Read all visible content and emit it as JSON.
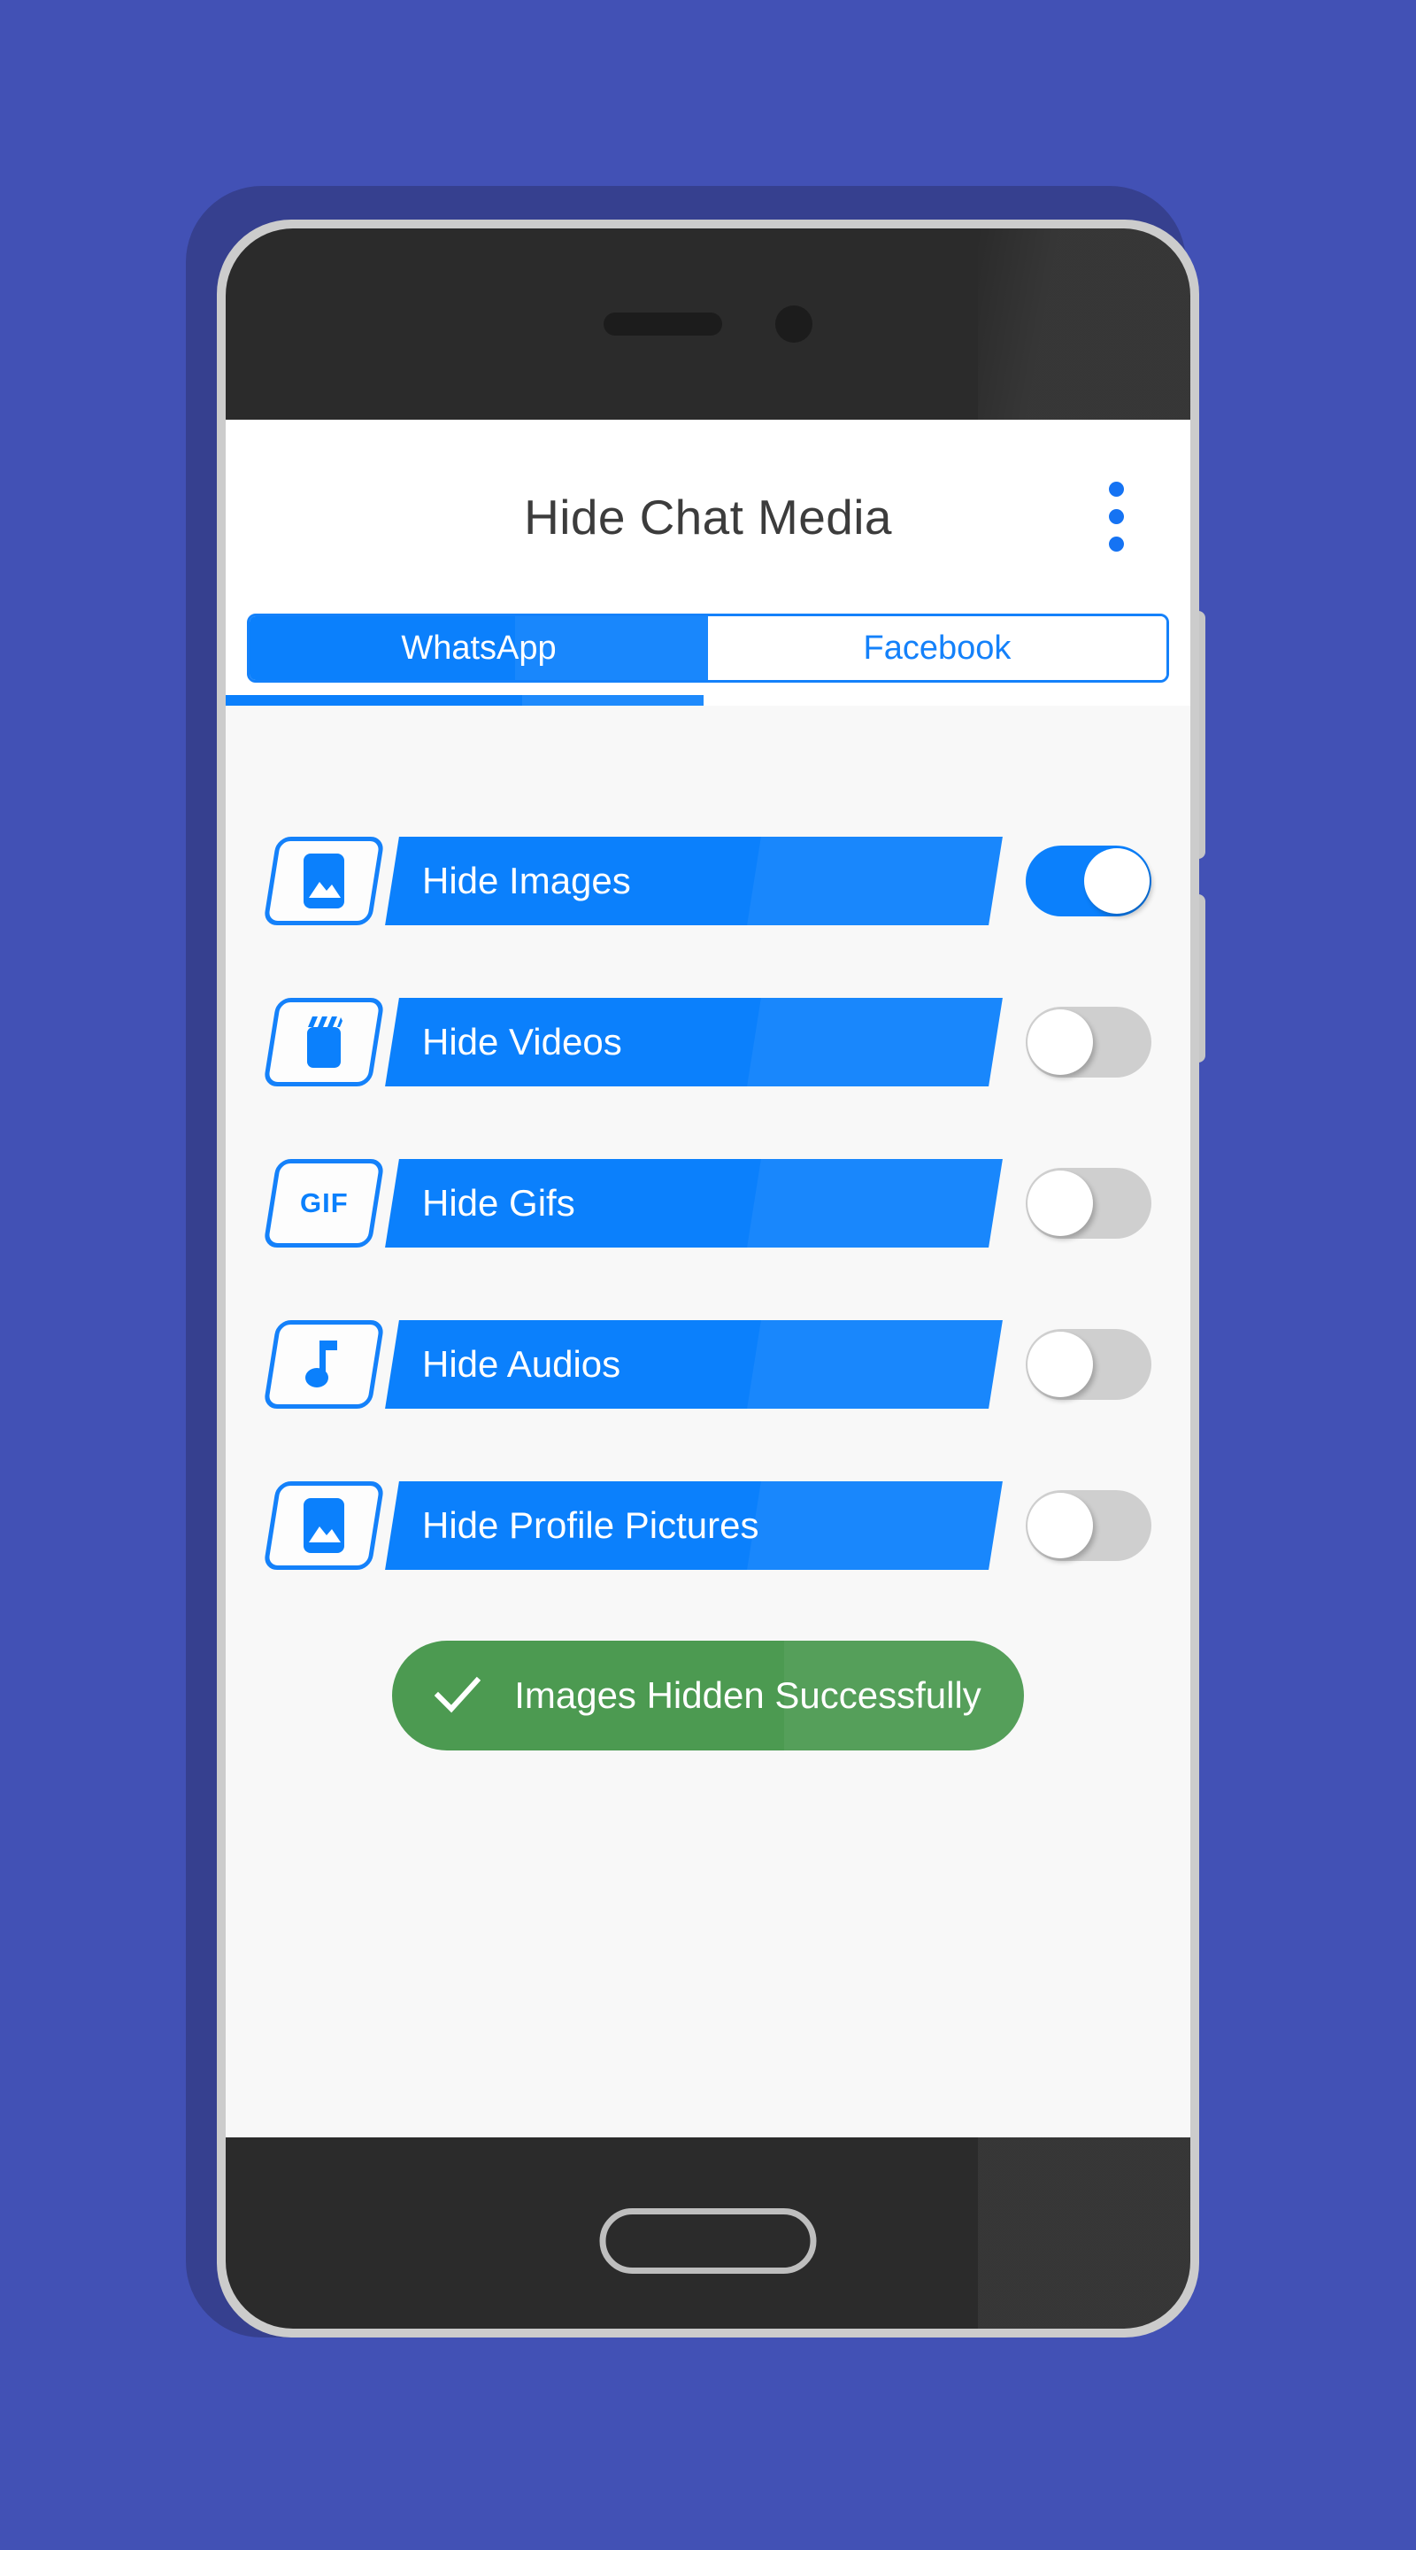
{
  "app": {
    "title": "Hide Chat Media",
    "overflow_menu_icon": "three-dots-vertical-icon"
  },
  "tabs": [
    {
      "label": "WhatsApp",
      "active": true
    },
    {
      "label": "Facebook",
      "active": false
    }
  ],
  "media_rows": [
    {
      "label": "Hide Images",
      "icon": "image-icon",
      "toggle": "on"
    },
    {
      "label": "Hide Videos",
      "icon": "clapperboard-icon",
      "toggle": "off"
    },
    {
      "label": "Hide Gifs",
      "icon": "gif-icon",
      "icon_text": "GIF",
      "toggle": "off"
    },
    {
      "label": "Hide Audios",
      "icon": "music-note-icon",
      "toggle": "off"
    },
    {
      "label": "Hide Profile Pictures",
      "icon": "image-icon",
      "toggle": "off"
    }
  ],
  "status_button": {
    "label": "Images Hidden Successfully",
    "icon": "check-icon"
  },
  "colors": {
    "background": "#4251B5",
    "background_shadow": "#36408F",
    "frame": "#CCCCCC",
    "body": "#2B2B2B",
    "screen": "#F8F8F8",
    "accent_blue": "#0B80FC",
    "accent_blue_border": "#1481FA",
    "title_text": "#3C3C3C",
    "toggle_off": "#CFCFCF",
    "success_green": "#4C9A51"
  },
  "hardware": {
    "speaker": "speaker-grille",
    "camera": "front-camera-icon",
    "home": "home-button",
    "side_buttons": [
      "volume-button",
      "power-button"
    ]
  }
}
